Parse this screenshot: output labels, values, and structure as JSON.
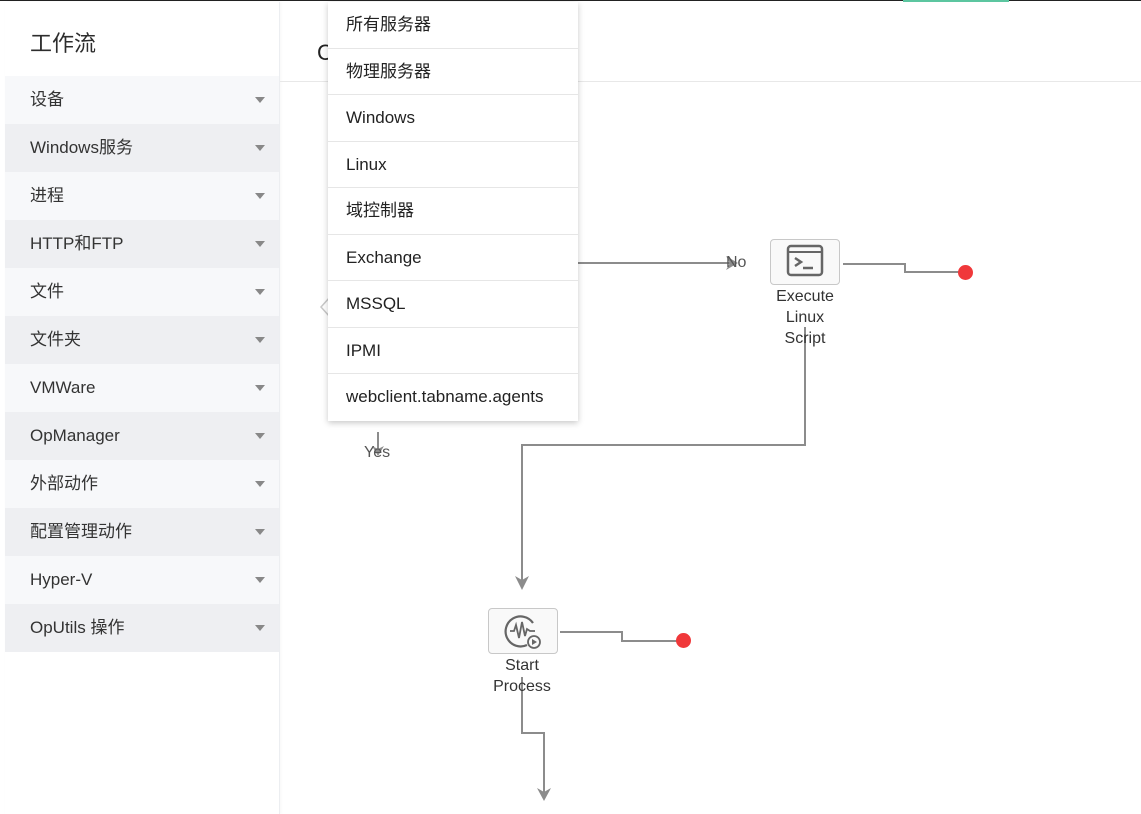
{
  "sidebar": {
    "title": "工作流",
    "categories": [
      {
        "label": "设备"
      },
      {
        "label": "Windows服务"
      },
      {
        "label": "进程"
      },
      {
        "label": "HTTP和FTP"
      },
      {
        "label": "文件"
      },
      {
        "label": "文件夹"
      },
      {
        "label": "VMWare"
      },
      {
        "label": "OpManager"
      },
      {
        "label": "外部动作"
      },
      {
        "label": "配置管理动作"
      },
      {
        "label": "Hyper-V"
      },
      {
        "label": "OpUtils 操作"
      }
    ]
  },
  "header": {
    "title_partial": "C"
  },
  "dropdown": {
    "items": [
      {
        "label": "所有服务器"
      },
      {
        "label": "物理服务器"
      },
      {
        "label": "Windows"
      },
      {
        "label": "Linux"
      },
      {
        "label": "域控制器"
      },
      {
        "label": "Exchange"
      },
      {
        "label": "MSSQL"
      },
      {
        "label": "IPMI"
      },
      {
        "label": "webclient.tabname.agents"
      }
    ]
  },
  "flow": {
    "edge_labels": {
      "no": "No",
      "yes": "Yes"
    },
    "nodes": [
      {
        "id": "execute-linux-script",
        "icon": "terminal-icon",
        "label_lines": [
          "Execute",
          "Linux",
          "Script"
        ]
      },
      {
        "id": "start-process",
        "icon": "process-activity-icon",
        "label_lines": [
          "Start",
          "Process"
        ]
      }
    ],
    "colors": {
      "end_dot": "#f0383a",
      "connector": "#8c8c8c"
    }
  }
}
